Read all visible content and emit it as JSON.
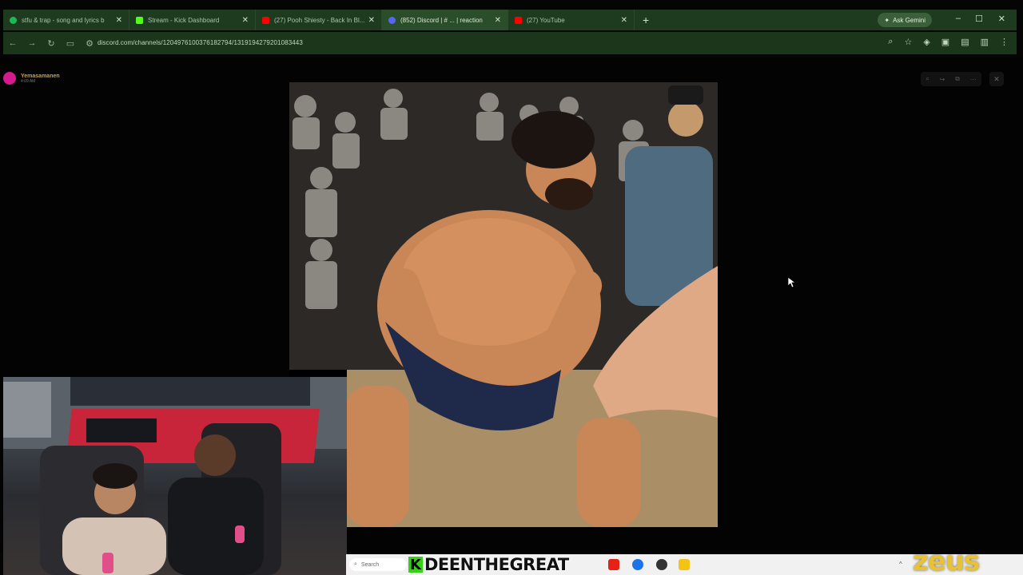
{
  "browser": {
    "tabs": [
      {
        "label": "stfu & trap - song and lyrics b",
        "color": "#1db954"
      },
      {
        "label": "Stream - Kick Dashboard",
        "color": "#53fc18"
      },
      {
        "label": "(27) Pooh Shiesty - Back In Bl...",
        "color": "#ff0000"
      },
      {
        "label": "(852) Discord | # ... | reaction",
        "color": "#5865f2"
      },
      {
        "label": "(27) YouTube",
        "color": "#ff0000"
      }
    ],
    "new_tab": "+",
    "ask_gemini": "Ask Gemini",
    "url": "discord.com/channels/1204976100376182794/1319194279201083443"
  },
  "discord": {
    "poster_name": "Yemasamanen",
    "poster_time": "4:09 AM"
  },
  "taskbar": {
    "search_placeholder": "Search",
    "stream_badge": "K",
    "streamer_name": "DEENTHEGREAT"
  },
  "watermark": "zeus",
  "colors": {
    "tab_bar": "#1f3b1f",
    "url_bar": "#1b361b",
    "kick_green": "#34d117",
    "zeus_gold": "#e9c233",
    "discord_avatar": "#d51a8e"
  },
  "icons": [
    "globe-icon",
    "reload-icon",
    "star-icon",
    "zoom-icon",
    "extension-icon",
    "windows-search-icon"
  ]
}
